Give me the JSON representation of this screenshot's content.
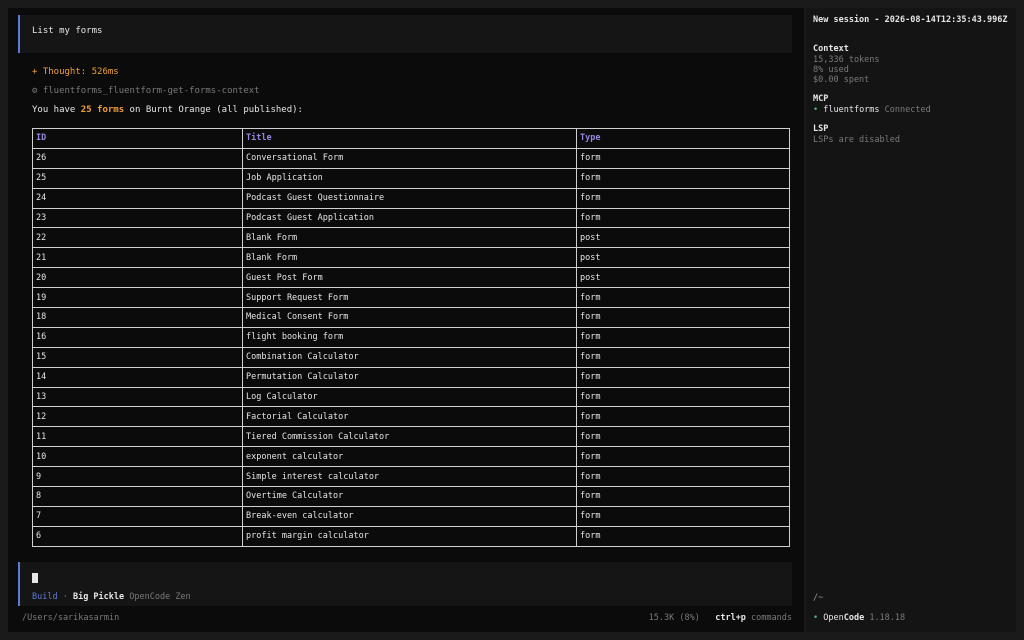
{
  "user_message": "List my forms",
  "thought": "+ Thought: 526ms",
  "tool_call": "⚙ fluentforms_fluentform-get-forms-context",
  "summary": {
    "prefix": "You have ",
    "highlight": "25 forms",
    "suffix": " on Burnt Orange (all published):"
  },
  "table": {
    "headers": [
      "ID",
      "Title",
      "Type"
    ],
    "rows": [
      [
        "26",
        "Conversational Form",
        "form"
      ],
      [
        "25",
        "Job Application",
        "form"
      ],
      [
        "24",
        "Podcast Guest Questionnaire",
        "form"
      ],
      [
        "23",
        "Podcast Guest Application",
        "form"
      ],
      [
        "22",
        "Blank Form",
        "post"
      ],
      [
        "21",
        "Blank Form",
        "post"
      ],
      [
        "20",
        "Guest Post Form",
        "post"
      ],
      [
        "19",
        "Support Request Form",
        "form"
      ],
      [
        "18",
        "Medical Consent Form",
        "form"
      ],
      [
        "16",
        "flight booking form",
        "form"
      ],
      [
        "15",
        "Combination Calculator",
        "form"
      ],
      [
        "14",
        "Permutation Calculator",
        "form"
      ],
      [
        "13",
        "Log Calculator",
        "form"
      ],
      [
        "12",
        "Factorial Calculator",
        "form"
      ],
      [
        "11",
        "Tiered Commission Calculator",
        "form"
      ],
      [
        "10",
        "exponent calculator",
        "form"
      ],
      [
        "9",
        "Simple interest calculator",
        "form"
      ],
      [
        "8",
        "Overtime Calculator",
        "form"
      ],
      [
        "7",
        "Break-even calculator",
        "form"
      ],
      [
        "6",
        "profit margin calculator",
        "form"
      ]
    ]
  },
  "input": {
    "agent": "Build",
    "separator": " · ",
    "model": "Big Pickle",
    "provider": " OpenCode Zen"
  },
  "footer": {
    "cwd": "/Users/sarikasarmin",
    "tokens": "15.3K (8%)",
    "shortcut_key": "ctrl+p",
    "shortcut_label": " commands"
  },
  "sidebar": {
    "session_title": "New session - 2026-08-14T12:35:43.996Z",
    "context_heading": "Context",
    "context_tokens": "15,336 tokens",
    "context_used": "8% used",
    "context_spent": "$0.00 spent",
    "mcp_heading": "MCP",
    "mcp_dot": "•",
    "mcp_name": "fluentforms",
    "mcp_status": " Connected",
    "lsp_heading": "LSP",
    "lsp_status": "LSPs are disabled",
    "path": "/~",
    "version_dot": "•",
    "version_open": " Open",
    "version_code": "Code",
    "version_num": " 1.18.18"
  }
}
